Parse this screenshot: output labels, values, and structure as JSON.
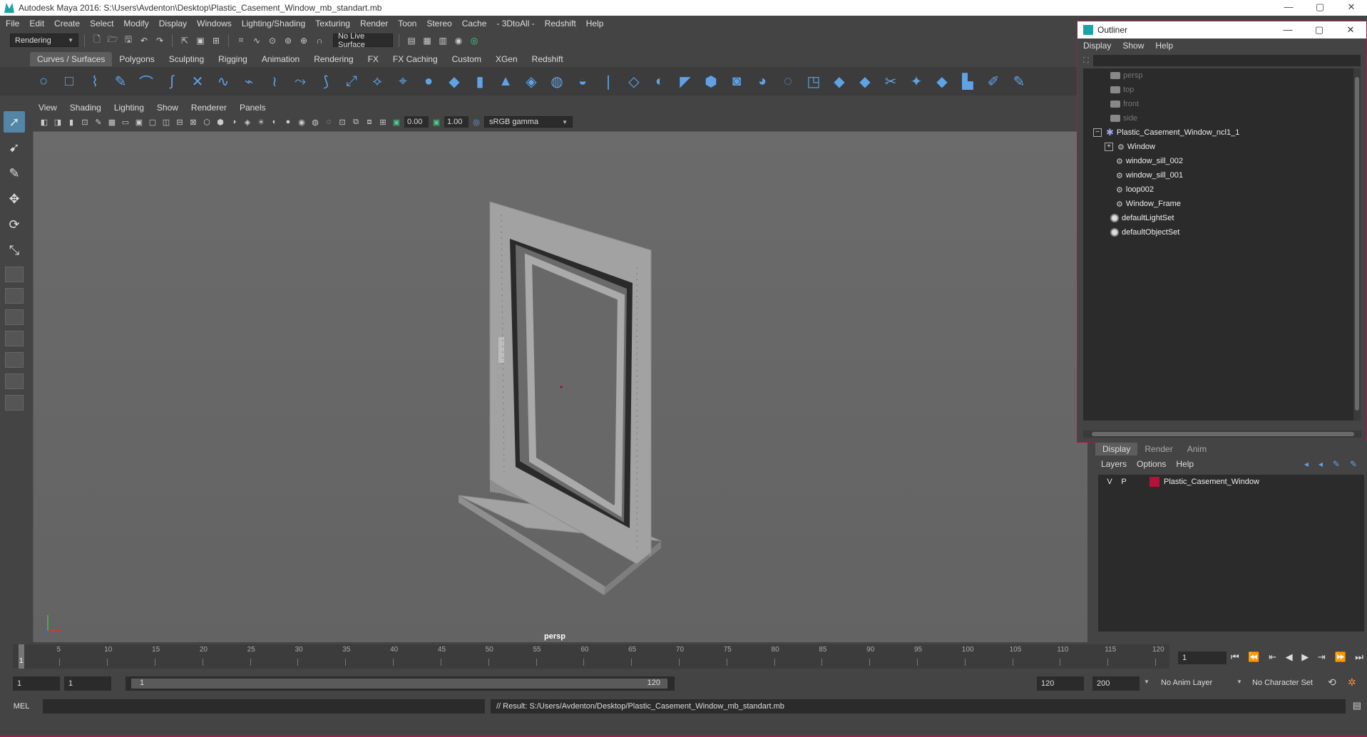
{
  "window": {
    "title": "Autodesk Maya 2016: S:\\Users\\Avdenton\\Desktop\\Plastic_Casement_Window_mb_standart.mb",
    "controls": [
      "—",
      "▢",
      "✕"
    ]
  },
  "menubar": [
    "File",
    "Edit",
    "Create",
    "Select",
    "Modify",
    "Display",
    "Windows",
    "Lighting/Shading",
    "Texturing",
    "Render",
    "Toon",
    "Stereo",
    "Cache",
    "- 3DtoAll -",
    "Redshift",
    "Help"
  ],
  "statusline": {
    "menuset": "Rendering",
    "live_surface": "No Live Surface"
  },
  "shelf": {
    "tabs": [
      "Curves / Surfaces",
      "Polygons",
      "Sculpting",
      "Rigging",
      "Animation",
      "Rendering",
      "FX",
      "FX Caching",
      "Custom",
      "XGen",
      "Redshift"
    ],
    "active_tab": "Curves / Surfaces"
  },
  "panel": {
    "menus": [
      "View",
      "Shading",
      "Lighting",
      "Show",
      "Renderer",
      "Panels"
    ],
    "exposure": "0.00",
    "gamma": "1.00",
    "color_space": "sRGB gamma",
    "camera_label": "persp"
  },
  "outliner": {
    "title": "Outliner",
    "menus": [
      "Display",
      "Show",
      "Help"
    ],
    "items": [
      {
        "label": "persp",
        "kind": "camera",
        "indent": 0
      },
      {
        "label": "top",
        "kind": "camera",
        "indent": 0
      },
      {
        "label": "front",
        "kind": "camera",
        "indent": 0
      },
      {
        "label": "side",
        "kind": "camera",
        "indent": 0
      },
      {
        "label": "Plastic_Casement_Window_ncl1_1",
        "kind": "group",
        "indent": 0
      },
      {
        "label": "Window",
        "kind": "mesh-expand",
        "indent": 1
      },
      {
        "label": "window_sill_002",
        "kind": "mesh",
        "indent": 1
      },
      {
        "label": "window_sill_001",
        "kind": "mesh",
        "indent": 1
      },
      {
        "label": "loop002",
        "kind": "mesh",
        "indent": 1
      },
      {
        "label": "Window_Frame",
        "kind": "mesh",
        "indent": 1
      },
      {
        "label": "defaultLightSet",
        "kind": "set",
        "indent": 0
      },
      {
        "label": "defaultObjectSet",
        "kind": "set",
        "indent": 0
      }
    ]
  },
  "layers": {
    "tabs": [
      "Display",
      "Render",
      "Anim"
    ],
    "active_tab": "Display",
    "menus": [
      "Layers",
      "Options",
      "Help"
    ],
    "rows": [
      {
        "v": "V",
        "p": "P",
        "color": "#b3123a",
        "name": "Plastic_Casement_Window"
      }
    ]
  },
  "timeline": {
    "ticks": [
      "5",
      "10",
      "15",
      "20",
      "25",
      "30",
      "35",
      "40",
      "45",
      "50",
      "55",
      "60",
      "65",
      "70",
      "75",
      "80",
      "85",
      "90",
      "95",
      "100",
      "105",
      "110",
      "115",
      "120"
    ],
    "current_frame": "1",
    "current_field": "1",
    "playback_icons": [
      "⏮",
      "⏪",
      "⇤",
      "◀",
      "▶",
      "⇥",
      "⏩",
      "⏭"
    ]
  },
  "range": {
    "start": "1",
    "start2": "1",
    "slider_start": "1",
    "slider_end": "120",
    "end": "120",
    "end2": "200",
    "anim_layer": "No Anim Layer",
    "char_set": "No Character Set"
  },
  "command": {
    "lang": "MEL",
    "result": "// Result: S:/Users/Avdenton/Desktop/Plastic_Casement_Window_mb_standart.mb"
  }
}
